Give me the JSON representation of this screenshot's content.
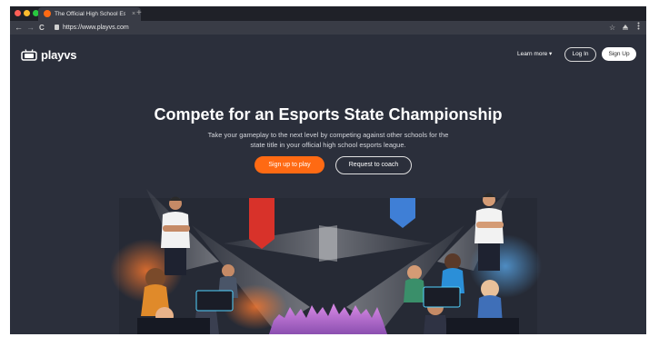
{
  "browser": {
    "tab_title": "The Official High School Espor",
    "tab_close": "×",
    "new_tab": "+",
    "url": "https://www.playvs.com",
    "nav_back": "←",
    "nav_forward": "→",
    "nav_reload": "C",
    "star": "☆",
    "colors": {
      "close": "#ff5f57",
      "minimize": "#febc2e",
      "maximize": "#28c840"
    }
  },
  "site": {
    "logo_text": "playvs",
    "nav": {
      "learn_more": "Learn more ▾",
      "log_in": "Log In",
      "sign_up": "Sign Up"
    },
    "hero": {
      "title": "Compete for an Esports State Championship",
      "subtitle": "Take your gameplay to the next level by competing against other schools for the state title in your official high school esports league.",
      "primary_cta": "Sign up to play",
      "secondary_cta": "Request to coach"
    },
    "colors": {
      "background": "#2b2f3b",
      "accent": "#ff6a13",
      "red_banner": "#d8322a",
      "blue_banner": "#3f7fd6",
      "crowd": "#c07ad8"
    }
  }
}
